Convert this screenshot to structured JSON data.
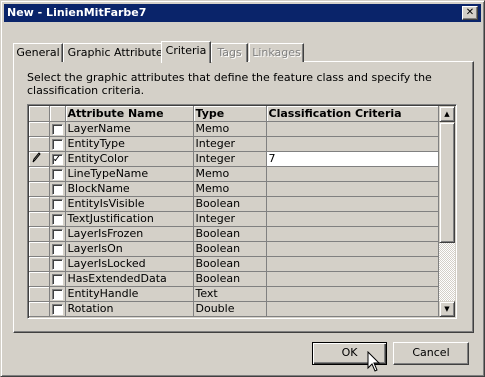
{
  "window": {
    "title": "New - LinienMitFarbe7",
    "close_glyph": "✕"
  },
  "tabs": [
    {
      "label": "General",
      "disabled": false
    },
    {
      "label": "Graphic Attributes",
      "disabled": false
    },
    {
      "label": "Criteria",
      "disabled": false,
      "active": true
    },
    {
      "label": "Tags",
      "disabled": true
    },
    {
      "label": "Linkages",
      "disabled": true
    }
  ],
  "instructions": "Select the graphic attributes that define the feature class and specify the classification criteria.",
  "grid": {
    "headers": {
      "name": "Attribute Name",
      "type": "Type",
      "criteria": "Classification Criteria"
    },
    "rows": [
      {
        "name": "LayerName",
        "type": "Memo",
        "checked": false,
        "criteria": ""
      },
      {
        "name": "EntityType",
        "type": "Integer",
        "checked": false,
        "criteria": ""
      },
      {
        "name": "EntityColor",
        "type": "Integer",
        "checked": true,
        "criteria": "7",
        "editing": true
      },
      {
        "name": "LineTypeName",
        "type": "Memo",
        "checked": false,
        "criteria": ""
      },
      {
        "name": "BlockName",
        "type": "Memo",
        "checked": false,
        "criteria": ""
      },
      {
        "name": "EntityIsVisible",
        "type": "Boolean",
        "checked": false,
        "criteria": ""
      },
      {
        "name": "TextJustification",
        "type": "Integer",
        "checked": false,
        "criteria": ""
      },
      {
        "name": "LayerIsFrozen",
        "type": "Boolean",
        "checked": false,
        "criteria": ""
      },
      {
        "name": "LayerIsOn",
        "type": "Boolean",
        "checked": false,
        "criteria": ""
      },
      {
        "name": "LayerIsLocked",
        "type": "Boolean",
        "checked": false,
        "criteria": ""
      },
      {
        "name": "HasExtendedData",
        "type": "Boolean",
        "checked": false,
        "criteria": ""
      },
      {
        "name": "EntityHandle",
        "type": "Text",
        "checked": false,
        "criteria": ""
      },
      {
        "name": "Rotation",
        "type": "Double",
        "checked": false,
        "criteria": ""
      }
    ]
  },
  "buttons": {
    "ok": "OK",
    "cancel": "Cancel"
  },
  "icons": {
    "edit_row": "pencil-icon",
    "checkbox_mark": "✓",
    "scroll_up": "▲",
    "scroll_down": "▼"
  }
}
